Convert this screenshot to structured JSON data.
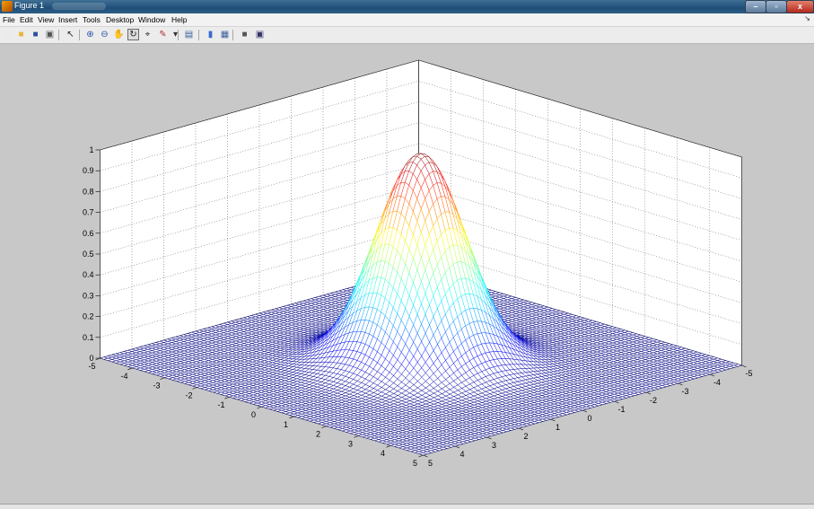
{
  "window": {
    "title": "Figure 1",
    "minimize": "–",
    "maximize": "▫",
    "close": "x"
  },
  "menu": [
    "File",
    "Edit",
    "View",
    "Insert",
    "Tools",
    "Desktop",
    "Window",
    "Help"
  ],
  "menu_arrow": "↘",
  "toolbar": [
    {
      "name": "new-figure",
      "glyph": "▯",
      "color": "#e8e8e8"
    },
    {
      "name": "open-file",
      "glyph": "■",
      "color": "#e7b53a"
    },
    {
      "name": "save",
      "glyph": "■",
      "color": "#2b4fa0"
    },
    {
      "name": "print",
      "glyph": "▣",
      "color": "#555555"
    },
    {
      "name": "edit-plot",
      "glyph": "↖",
      "color": "#222222"
    },
    {
      "name": "zoom-in",
      "glyph": "⊕",
      "color": "#2b55a8"
    },
    {
      "name": "zoom-out",
      "glyph": "⊖",
      "color": "#2b55a8"
    },
    {
      "name": "pan",
      "glyph": "✋",
      "color": "#8a6a33"
    },
    {
      "name": "rotate-3d",
      "glyph": "↻",
      "color": "#222222",
      "active": true
    },
    {
      "name": "data-cursor",
      "glyph": "⌖",
      "color": "#333333"
    },
    {
      "name": "brush",
      "glyph": "✎",
      "color": "#b03030"
    },
    {
      "name": "brush-dropdown",
      "glyph": "▾",
      "color": "#333333"
    },
    {
      "name": "link-plot",
      "glyph": "▤",
      "color": "#3a5e9a"
    },
    {
      "name": "insert-colorbar",
      "glyph": "▮",
      "color": "#3a6ad0"
    },
    {
      "name": "insert-legend",
      "glyph": "▦",
      "color": "#3a5e9a"
    },
    {
      "name": "hide-plot-tools",
      "glyph": "■",
      "color": "#555555"
    },
    {
      "name": "show-plot-tools",
      "glyph": "▣",
      "color": "#333366"
    }
  ],
  "chart_data": {
    "type": "surface-mesh",
    "function": "exp(-(x^2+y^2)/2)",
    "colormap": "jet",
    "x_range": [
      -5,
      5
    ],
    "y_range": [
      -5,
      5
    ],
    "z_range": [
      0,
      1
    ],
    "x_ticks": [
      "-5",
      "-4",
      "-3",
      "-2",
      "-1",
      "0",
      "1",
      "2",
      "3",
      "4",
      "5"
    ],
    "y_ticks": [
      "-5",
      "-4",
      "-3",
      "-2",
      "-1",
      "0",
      "1",
      "2",
      "3",
      "4",
      "5"
    ],
    "z_ticks": [
      "0",
      "0.1",
      "0.2",
      "0.3",
      "0.4",
      "0.5",
      "0.6",
      "0.7",
      "0.8",
      "0.9",
      "1"
    ],
    "peak": {
      "x": 0,
      "y": 0,
      "z": 1
    },
    "grid": true,
    "view": "3-D default"
  }
}
